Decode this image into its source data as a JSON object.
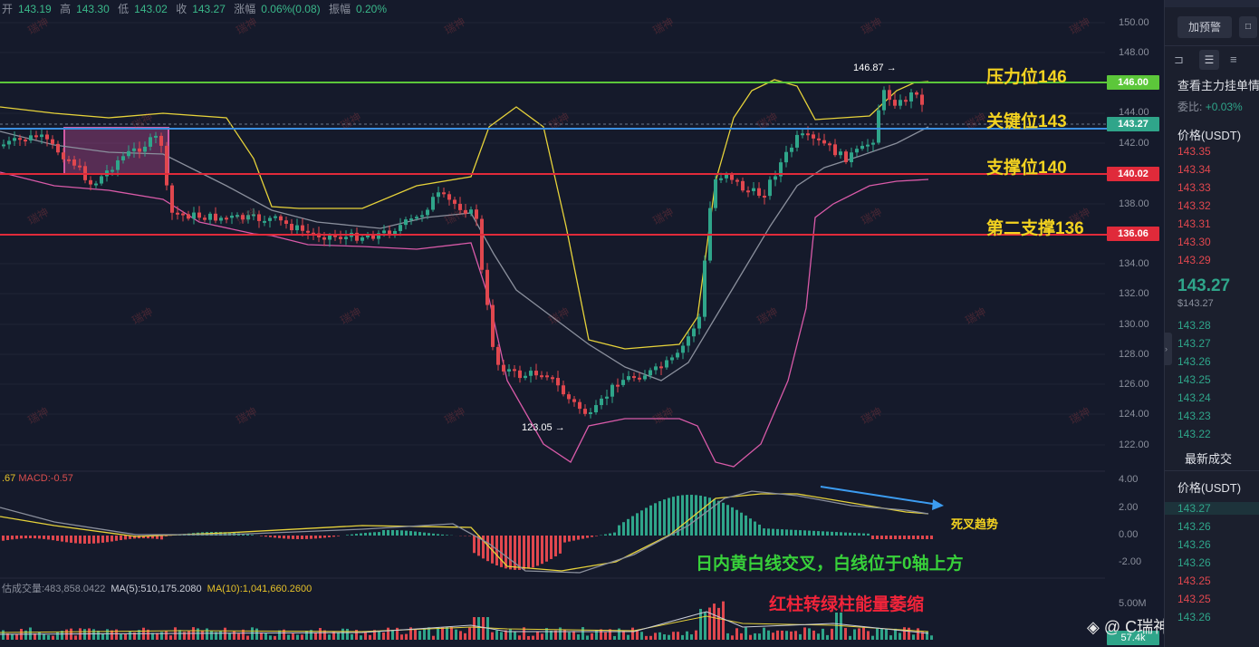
{
  "ohlc": {
    "open_label": "开",
    "open": "143.19",
    "high_label": "高",
    "high": "143.30",
    "low_label": "低",
    "low": "143.02",
    "close_label": "收",
    "close": "143.27",
    "change_label": "涨幅",
    "change": "0.06%(0.08)",
    "amp_label": "振幅",
    "amp": "0.20%"
  },
  "price_axis": {
    "ticks": [
      "150.00",
      "148.00",
      "144.00",
      "142.00",
      "138.00",
      "134.00",
      "132.00",
      "130.00",
      "128.00",
      "126.00",
      "124.00",
      "122.00"
    ],
    "tags": {
      "resistance": "146.00",
      "current": "143.27",
      "support": "140.02",
      "support2": "136.06"
    }
  },
  "annotations": {
    "resistance": "压力位146",
    "key": "关键位143",
    "support": "支撑位140",
    "support2": "第二支撑136",
    "high_marker": "146.87",
    "low_marker": "123.05",
    "death_cross": "死叉趋势",
    "macd_note": "日内黄白线交叉，白线位于0轴上方",
    "volume_note": "红柱转绿柱能量萎缩"
  },
  "macd": {
    "label_prefix": ".67",
    "label": "MACD:-0.57",
    "ticks": [
      "4.00",
      "2.00",
      "0.00",
      "-2.00"
    ]
  },
  "volume": {
    "label": "估成交量:483,858.0422",
    "ma5": "MA(5):510,175.2080",
    "ma10": "MA(10):1,041,660.2600",
    "ticks": [
      "5.00M"
    ],
    "current_tag": "57.4k"
  },
  "sidebar": {
    "add_alert": "加预警",
    "order_book_title": "查看主力挂单情",
    "ratio_label": "委比:",
    "ratio_value": "+0.03%",
    "price_header": "价格(USDT)",
    "asks": [
      "143.35",
      "143.34",
      "143.33",
      "143.32",
      "143.31",
      "143.30",
      "143.29"
    ],
    "last_price": "143.27",
    "last_price_usd": "$143.27",
    "bids": [
      "143.28",
      "143.27",
      "143.26",
      "143.25",
      "143.24",
      "143.23",
      "143.22"
    ],
    "trades_title": "最新成交",
    "trades_header": "价格(USDT)",
    "trades": [
      "143.27",
      "143.26",
      "143.26",
      "143.26",
      "143.25",
      "143.25",
      "143.26"
    ]
  },
  "watermark": "瑞神",
  "credit": "@ C瑞神o瑞神",
  "colors": {
    "bg": "#151a2b",
    "green_line": "#5cc73a",
    "blue_line": "#3c8fe0",
    "red_line": "#e02a3a",
    "up": "#2fa58a",
    "down": "#e0474e",
    "annotation_yellow": "#f4d320",
    "annotation_green": "#38d13a",
    "annotation_red": "#f2243a"
  }
}
